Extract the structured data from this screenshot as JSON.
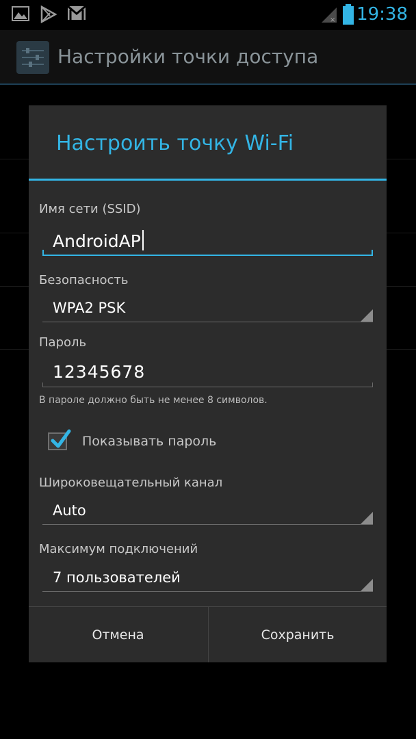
{
  "status_bar": {
    "time": "19:38",
    "icons": [
      "image-icon",
      "play-store-icon",
      "gmail-icon",
      "signal-icon",
      "battery-icon"
    ]
  },
  "action_bar": {
    "title": "Настройки точки доступа",
    "icon": "settings-sliders-icon"
  },
  "dialog": {
    "title": "Настроить точку Wi-Fi",
    "ssid": {
      "label": "Имя сети (SSID)",
      "value": "AndroidAP"
    },
    "security": {
      "label": "Безопасность",
      "value": "WPA2 PSK"
    },
    "password": {
      "label": "Пароль",
      "value": "12345678",
      "hint": "В пароле должно быть не менее 8 символов."
    },
    "show_password": {
      "label": "Показывать пароль",
      "checked": true
    },
    "channel": {
      "label": "Широковещательный канал",
      "value": "Auto"
    },
    "max_connections": {
      "label": "Максимум подключений",
      "value": "7 пользователей"
    },
    "buttons": {
      "cancel": "Отмена",
      "save": "Сохранить"
    }
  },
  "colors": {
    "accent": "#33b5e5",
    "dialog_bg": "#2c2c2c",
    "background": "#000000"
  }
}
